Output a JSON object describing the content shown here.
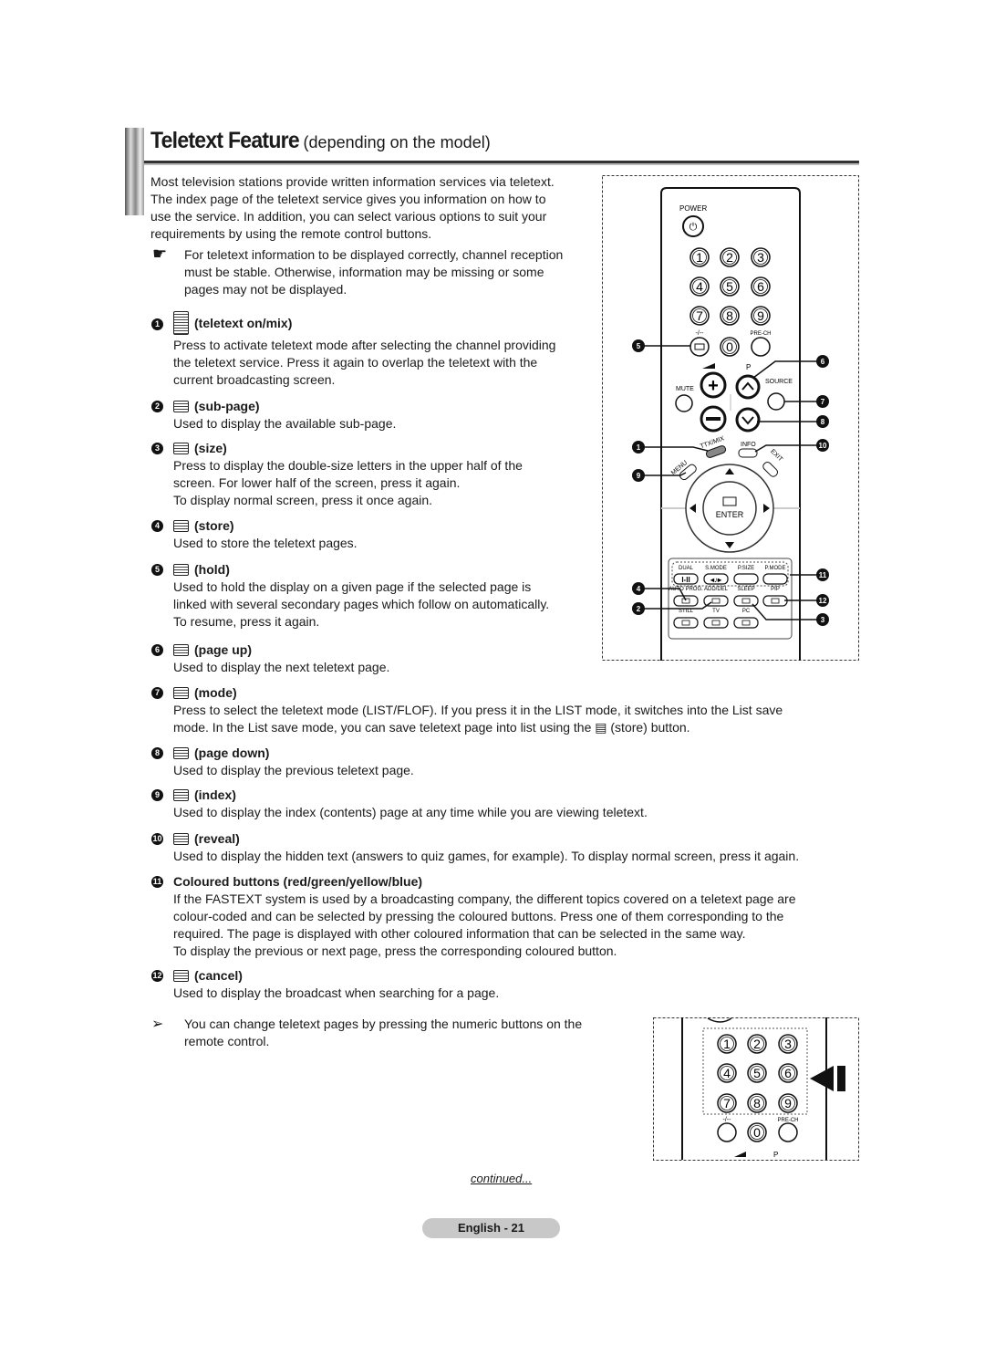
{
  "header": {
    "title": "Teletext Feature",
    "subtitle": "(depending on the model)"
  },
  "intro": [
    "Most television stations provide written information services via teletext.",
    "The index page of the teletext service gives you information on how to",
    "use the service. In addition, you can select various options to suit your",
    "requirements by using the remote control buttons."
  ],
  "note": {
    "icon": "pointing-hand-icon",
    "symbol": "☛",
    "lines": [
      "For teletext information to be displayed correctly, channel reception",
      "must be stable. Otherwise, information may be missing or some",
      "pages may not be displayed."
    ]
  },
  "items": [
    {
      "num": "1",
      "title": "(teletext on/mix)",
      "lines": [
        "Press to activate teletext mode after selecting the channel providing",
        "the teletext service. Press it again to overlap the teletext with the",
        "current broadcasting screen."
      ]
    },
    {
      "num": "2",
      "title": "(sub-page)",
      "lines": [
        "Used to display the available sub-page."
      ]
    },
    {
      "num": "3",
      "title": "(size)",
      "lines": [
        "Press to display the double-size letters in the upper half of the",
        "screen. For lower half of the screen, press it again.",
        "To display normal screen, press it once again."
      ]
    },
    {
      "num": "4",
      "title": "(store)",
      "lines": [
        "Used to store the teletext pages."
      ]
    },
    {
      "num": "5",
      "title": "(hold)",
      "lines": [
        "Used to hold the display on a given page if the selected page is",
        "linked with several secondary pages which follow on automatically.",
        "To resume, press it again."
      ]
    },
    {
      "num": "6",
      "title": "(page up)",
      "lines": [
        "Used to display the next teletext page."
      ]
    },
    {
      "num": "7",
      "title": "(mode)",
      "lines": [
        "Press to select the teletext mode (LIST/FLOF). If you press it in the LIST mode, it switches into the List save",
        "mode. In the List save mode, you can save teletext page into list using the ▤ (store) button."
      ]
    },
    {
      "num": "8",
      "title": "(page down)",
      "lines": [
        "Used to display the previous teletext page."
      ]
    },
    {
      "num": "9",
      "title": "(index)",
      "lines": [
        "Used to display the index (contents) page at any time while you are viewing teletext."
      ]
    },
    {
      "num": "10",
      "title": "(reveal)",
      "lines": [
        "Used to display the hidden text (answers to quiz games, for example). To display normal screen, press it again."
      ]
    },
    {
      "num": "11",
      "title": "Coloured buttons (red/green/yellow/blue)",
      "noicon": true,
      "lines": [
        "If the FASTEXT system is used by a broadcasting company, the different topics covered on a teletext page are",
        "colour-coded and can be selected by pressing the coloured buttons. Press one of them corresponding to the",
        "required. The page is displayed with other coloured information that can be selected in the same way.",
        "To display the previous or next page, press the corresponding coloured button."
      ]
    },
    {
      "num": "12",
      "title": "(cancel)",
      "lines": [
        "Used to display the broadcast when searching for a page."
      ]
    }
  ],
  "tip": {
    "icon": "arrow-right-icon",
    "symbol": "➢",
    "lines": [
      "You can change teletext pages by pressing the numeric buttons on the",
      "remote control."
    ]
  },
  "remote": {
    "power": "POWER",
    "digits": [
      "1",
      "2",
      "3",
      "4",
      "5",
      "6",
      "7",
      "8",
      "9",
      "0"
    ],
    "dash": "-/--",
    "prech": "PRE-CH",
    "p": "P",
    "mute": "MUTE",
    "source": "SOURCE",
    "ttx": "TTX/MIX",
    "info": "INFO",
    "menu": "MENU",
    "exit": "EXIT",
    "enter": "ENTER",
    "row1": [
      "DUAL",
      "S.MODE",
      "P.SIZE",
      "P.MODE"
    ],
    "row1btn": [
      "I-II",
      "◂♪▸",
      "",
      ""
    ],
    "row2": [
      "AUTO PROG.",
      "ADD/DEL",
      "SLEEP",
      "PIP"
    ],
    "row3": [
      "STILL",
      "TV",
      "PC"
    ],
    "callouts": [
      "5",
      "6",
      "7",
      "8",
      "1",
      "10",
      "9",
      "11",
      "4",
      "12",
      "2",
      "3"
    ]
  },
  "footer": {
    "continued": "continued...",
    "page": "English - 21"
  }
}
